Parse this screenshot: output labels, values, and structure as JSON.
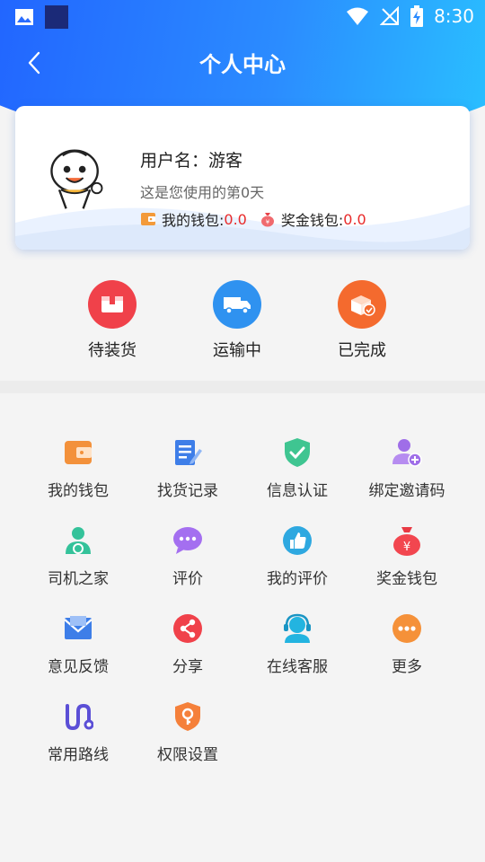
{
  "status_bar": {
    "time": "8:30"
  },
  "nav": {
    "title": "个人中心"
  },
  "profile": {
    "username_label": "用户名：游客",
    "days_text": "这是您使用的第0天",
    "wallet_label": "我的钱包:",
    "wallet_value": "0.0",
    "bonus_label": "奖金钱包:",
    "bonus_value": "0.0"
  },
  "orders": [
    {
      "label": "待装货",
      "icon": "box-icon",
      "color": "#f0414a"
    },
    {
      "label": "运输中",
      "icon": "truck-icon",
      "color": "#2f92f0"
    },
    {
      "label": "已完成",
      "icon": "package-check-icon",
      "color": "#f46a2e"
    }
  ],
  "menu": [
    {
      "label": "我的钱包",
      "icon": "wallet-icon"
    },
    {
      "label": "找货记录",
      "icon": "document-edit-icon"
    },
    {
      "label": "信息认证",
      "icon": "shield-check-icon"
    },
    {
      "label": "绑定邀请码",
      "icon": "user-add-icon"
    },
    {
      "label": "司机之家",
      "icon": "driver-icon"
    },
    {
      "label": "评价",
      "icon": "chat-bubble-icon"
    },
    {
      "label": "我的评价",
      "icon": "thumbs-up-icon"
    },
    {
      "label": "奖金钱包",
      "icon": "money-bag-icon"
    },
    {
      "label": "意见反馈",
      "icon": "mail-icon"
    },
    {
      "label": "分享",
      "icon": "share-icon"
    },
    {
      "label": "在线客服",
      "icon": "headset-icon"
    },
    {
      "label": "更多",
      "icon": "more-icon"
    },
    {
      "label": "常用路线",
      "icon": "route-icon"
    },
    {
      "label": "权限设置",
      "icon": "key-shield-icon"
    }
  ]
}
